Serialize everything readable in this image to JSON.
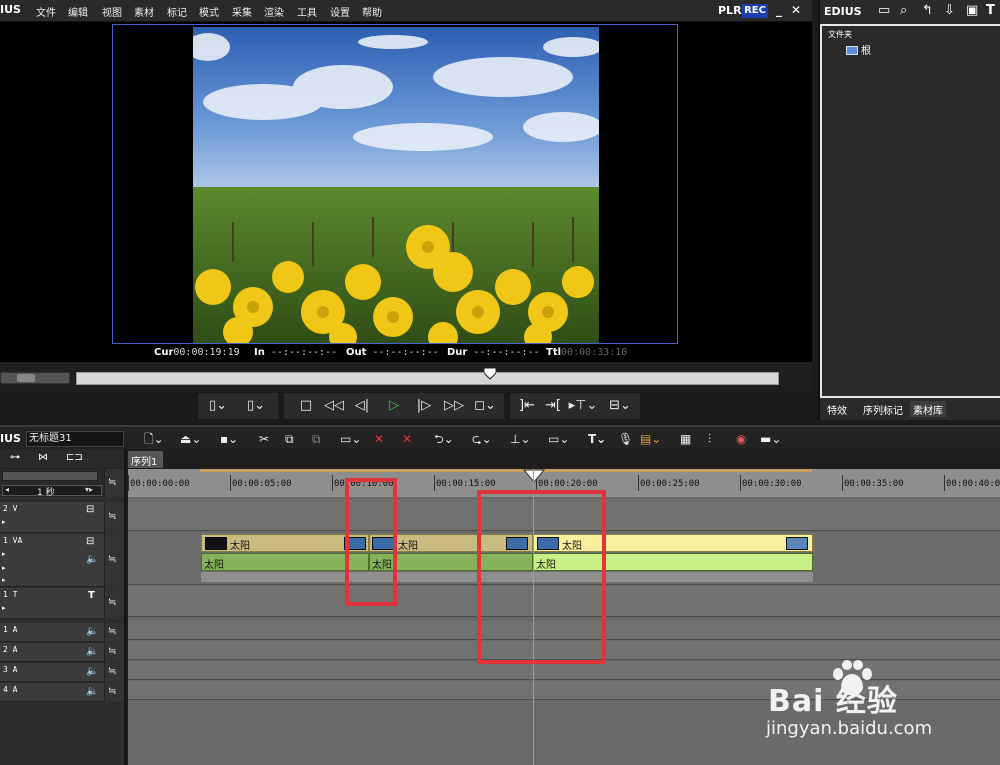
{
  "menubar": {
    "logo": "IUS",
    "items": [
      "文件",
      "编辑",
      "视图",
      "素材",
      "标记",
      "模式",
      "采集",
      "渲染",
      "工具",
      "设置",
      "帮助"
    ],
    "plr": "PLR",
    "rec": "REC",
    "minimize": "_",
    "close": "✕"
  },
  "preview": {
    "cur_label": "Cur",
    "cur_value": "00:00:19:19",
    "in_label": "In",
    "in_value": "--:--:--:--",
    "out_label": "Out",
    "out_value": "--:--:--:--",
    "dur_label": "Dur",
    "dur_value": "--:--:--:--",
    "ttl_label": "Ttl",
    "ttl_value": "00:00:33:10"
  },
  "bin": {
    "title": "EDIUS",
    "folders_label": "文件夹",
    "root": "根",
    "tabs": [
      "特效",
      "序列标记",
      "素材库"
    ]
  },
  "timeline": {
    "logo": "IUS",
    "project_name": "无标题31",
    "sequence_tab": "序列1",
    "scale_label": "1 秒",
    "ruler": [
      "00:00:00:00",
      "00:00:05:00",
      "00:00:10:00",
      "00:00:15:00",
      "00:00:20:00",
      "00:00:25:00",
      "00:00:30:00",
      "00:00:35:00",
      "00:00:40:0"
    ],
    "tracks": {
      "v2": "2 V",
      "va1": "1 VA",
      "t1": "1 T",
      "a1": "1 A",
      "a2": "2 A",
      "a3": "3 A",
      "a4": "4 A"
    },
    "clips": {
      "v1": "太阳",
      "v2": "太阳",
      "v3": "太阳",
      "a1": "太阳",
      "a2": "太阳",
      "a3": "太阳"
    }
  },
  "watermark": {
    "main": "Bai 经验",
    "sub": "jingyan.baidu.com"
  }
}
